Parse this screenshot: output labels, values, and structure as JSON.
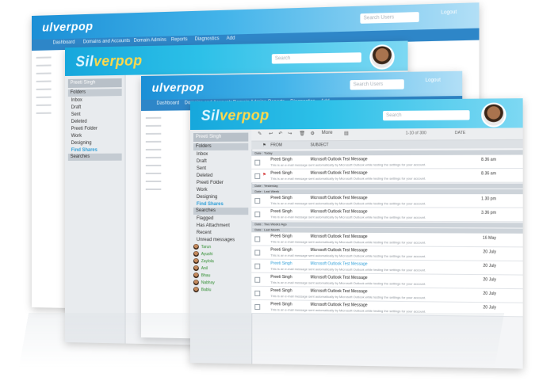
{
  "brand": {
    "prefix": "Sil",
    "suffix": "verpop",
    "small": "ulverpop"
  },
  "topnav": [
    "Dashboard",
    "Domains and Accounts",
    "Domain Admins",
    "Reports",
    "Diagnostics",
    "Add"
  ],
  "search_placeholder": "Search Users",
  "search_placeholder_mail": "Search",
  "logout": "Logout",
  "toolbar": {
    "more": "More",
    "pager": "1-10 of 300",
    "sort": "DATE"
  },
  "sidebar": {
    "search": "Preeti Singh",
    "folders_head": "Folders",
    "folders": [
      "Inbox",
      "Draft",
      "Sent",
      "Deleted",
      "Preeti Folder",
      "Work",
      "Designing"
    ],
    "find_shares": "Find Shares",
    "searches_head": "Searches",
    "searches": [
      "Flagged",
      "Has Attachment",
      "Recent",
      "Unread messages"
    ],
    "contacts": [
      "Tarun",
      "Ayushi",
      "Zaylola",
      "Anil",
      "Bhau",
      "Nabhay",
      "Bablu"
    ]
  },
  "columns": {
    "from": "FROM",
    "subject": "SUBJECT"
  },
  "groups": [
    "Date : Today",
    "Date : Yesterday",
    "Date : Last Week",
    "Date : Two Weeks Ago",
    "Date : Last Month"
  ],
  "messages": [
    {
      "from": "Preeti Singh",
      "subject": "Microsoft Outlook Test Message",
      "preview": "This is an e-mail message sent automatically by Microsoft Outlook while testing the settings for your account.",
      "date": "8.36 am"
    },
    {
      "from": "Preeti Singh",
      "subject": "Microsoft Outlook Test Message",
      "preview": "This is an e-mail message sent automatically by Microsoft Outlook while testing the settings for your account.",
      "date": "8.36 am"
    },
    {
      "from": "Preeti Singh",
      "subject": "Microsoft Outlook Test Message",
      "preview": "This is an e-mail message sent automatically by Microsoft Outlook while testing the settings for your account.",
      "date": "3.36 pm"
    },
    {
      "from": "Preeti Singh",
      "subject": "Microsoft Outlook Test Message",
      "preview": "This is an e-mail message sent automatically by Microsoft Outlook while testing the settings for your account.",
      "date": "1.30 pm"
    },
    {
      "from": "Preeti Singh",
      "subject": "Microsoft Outlook Test Message",
      "preview": "This is an e-mail message sent automatically by Microsoft Outlook while testing the settings for your account.",
      "date": "16 May"
    },
    {
      "from": "Preeti Singh",
      "subject": "Microsoft Outlook Test Message",
      "preview": "This is an e-mail message sent automatically by Microsoft Outlook while testing the settings for your account.",
      "date": "20 July"
    },
    {
      "from": "Preeti Singh",
      "subject": "Microsoft Outlook Test Message",
      "preview": "This is an e-mail message sent automatically by Microsoft Outlook while testing the settings for your account.",
      "date": "20 July"
    },
    {
      "from": "Preeti Singh",
      "subject": "Microsoft Outlook Test Message",
      "preview": "This is an e-mail message sent automatically by Microsoft Outlook while testing the settings for your account.",
      "date": "20 July"
    },
    {
      "from": "Preeti Singh",
      "subject": "Microsoft Outlook Test Message",
      "preview": "This is an e-mail message sent automatically by Microsoft Outlook while testing the settings for your account.",
      "date": "20 July"
    },
    {
      "from": "Preeti Singh",
      "subject": "Microsoft Outlook Test Message",
      "preview": "This is an e-mail message sent automatically by Microsoft Outlook while testing the settings for your account.",
      "date": "20 July"
    }
  ],
  "colors": {
    "accent": "#2f9fd8",
    "brand_top": "#16a7dc",
    "nav": "#2e86c8"
  }
}
